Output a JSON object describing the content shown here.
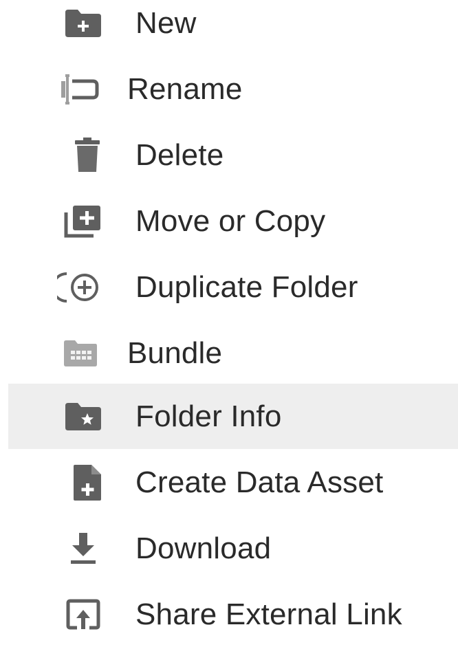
{
  "menu": {
    "items": [
      {
        "label": "New",
        "icon": "folder-plus-icon"
      },
      {
        "label": "Rename",
        "icon": "rename-cursor-icon"
      },
      {
        "label": "Delete",
        "icon": "trash-icon"
      },
      {
        "label": "Move or Copy",
        "icon": "copy-plus-icon"
      },
      {
        "label": "Duplicate Folder",
        "icon": "duplicate-plus-icon"
      },
      {
        "label": "Bundle",
        "icon": "folder-grid-icon"
      },
      {
        "label": "Folder Info",
        "icon": "folder-star-icon",
        "highlighted": true
      },
      {
        "label": "Create Data Asset",
        "icon": "file-plus-icon"
      },
      {
        "label": "Download",
        "icon": "download-icon"
      },
      {
        "label": "Share External Link",
        "icon": "share-upload-icon"
      }
    ]
  },
  "colors": {
    "icon": "#5f5f5f",
    "icon_light": "#9e9e9e",
    "text": "#2a2a2a",
    "highlight_bg": "#eeeeee"
  }
}
